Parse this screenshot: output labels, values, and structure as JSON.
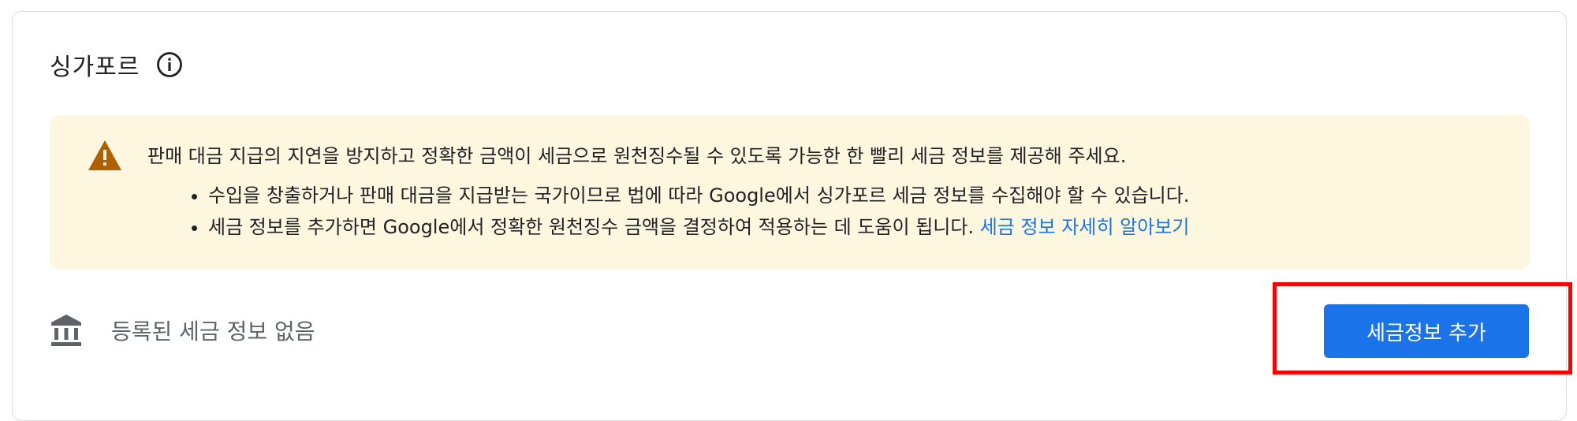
{
  "section": {
    "title": "싱가포르",
    "info_icon": "info-circle-icon"
  },
  "warning": {
    "icon": "warning-triangle-icon",
    "color": "#b06000",
    "background": "#fef7e0",
    "heading": "판매 대금 지급의 지연을 방지하고 정확한 금액이 세금으로 원천징수될 수 있도록 가능한 한 빨리 세금 정보를 제공해 주세요.",
    "bullets": [
      "수입을 창출하거나 판매 대금을 지급받는 국가이므로 법에 따라 Google에서 싱가포르 세금 정보를 수집해야 할 수 있습니다.",
      "세금 정보를 추가하면 Google에서 정확한 원천징수 금액을 결정하여 적용하는 데 도움이 됩니다."
    ],
    "link_label": "세금 정보 자세히 알아보기"
  },
  "tax_info": {
    "icon": "bank-icon",
    "empty_text": "등록된 세금 정보 없음",
    "add_button_label": "세금정보 추가",
    "accent_color": "#1a73e8"
  },
  "highlight_color": "#ff0000"
}
